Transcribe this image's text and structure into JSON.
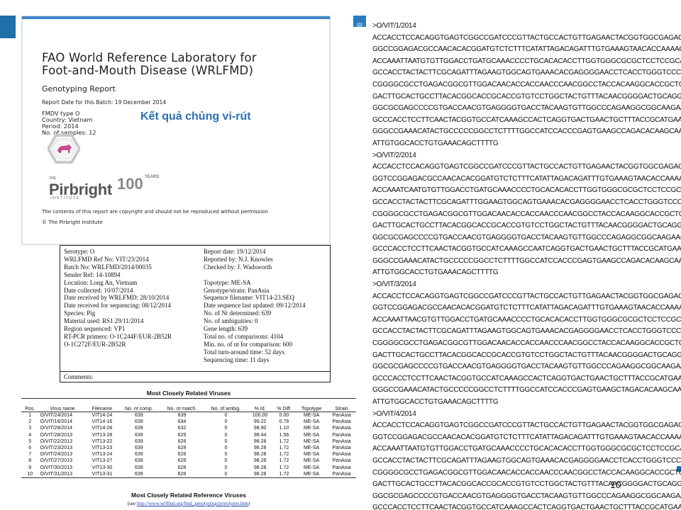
{
  "cover": {
    "title_line1": "FAO World Reference Laboratory for",
    "title_line2": "Foot-and-Mouth Disease (WRLFMD)",
    "subtitle": "Genotyping Report",
    "report_date_line": "Report Date for this Batch: 19 December 2014",
    "meta": [
      "FMDV type O",
      "Country: Vietnam",
      "Period: 2014",
      "No. of samples: 12"
    ],
    "overlay_label": "Kết quả chủng vi-rút",
    "logo_the": "THE",
    "logo_name": "Pirbright",
    "logo_years": "100",
    "logo_years_suffix": "YEARS",
    "logo_institute": "INSTITUTE",
    "copy_notice": "The contents of this report are copyright and should not be reproduced without permission",
    "copyright": "© The Pirbright Institute"
  },
  "details": {
    "left": [
      "Serotype: O",
      "WRLFMD Ref No: VIT/23/2014",
      "Batch No: WRLFMD/2014/00035",
      "Sender Ref: 14-10894",
      "Location: Long An, Vietnam",
      "Date collected: 10/07/2014",
      "Date received by WRLFMD: 28/10/2014",
      "Date received for sequencing: 08/12/2014",
      "Species: Pig",
      "Material used: RS1 29/11/2014",
      "Region sequenced: VP1",
      "RT-PCR primers: O-1C244F/EUR-2B52R",
      "                         O-1C272F/EUR-2B52R"
    ],
    "right": [
      "Report date: 19/12/2014",
      "Reported by: N.J. Knowles",
      "Checked by: J. Wadsworth",
      "",
      "Topotype: ME-SA",
      "Genotype/strain: PanAsia",
      "Sequence filename: VIT14-23.SEQ",
      "Date sequence last updated: 09/12/2014",
      "No. of Nt determined: 639",
      "No. of ambiguities: 0",
      "Gene length: 639",
      "Total no. of comparisons: 4104",
      "Min. no. of nt for comparison: 600",
      "Total turn-around time: 52 days",
      "Sequencing time: 11 days"
    ],
    "comments_label": "Comments:"
  },
  "related": {
    "title": "Most Closely Related Viruses",
    "headers": [
      "Pos.",
      "Virus name",
      "Filename",
      "No. nt comp.",
      "No. nt match.",
      "No. of ambig.",
      "% Id.",
      "% Diff.",
      "Topotype",
      "Strain"
    ],
    "rows": [
      [
        "1",
        "O/VIT/24/2014",
        "VIT14-24",
        "639",
        "639",
        "0",
        "100.00",
        "0.00",
        "ME-SA",
        "PanAsia"
      ],
      [
        "2",
        "O/VIT/16/2014",
        "VIT14-16",
        "639",
        "634",
        "0",
        "99.22",
        "0.78",
        "ME-SA",
        "PanAsia"
      ],
      [
        "3",
        "O/VIT/28/2014",
        "VIT14-28",
        "639",
        "632",
        "0",
        "98.90",
        "1.10",
        "ME-SA",
        "PanAsia"
      ],
      [
        "4",
        "O/VIT/28/2013",
        "VIT13-28",
        "639",
        "629",
        "0",
        "98.44",
        "1.56",
        "ME-SA",
        "PanAsia"
      ],
      [
        "5",
        "O/VIT/22/2013",
        "VIT13-22",
        "639",
        "628",
        "0",
        "98.28",
        "1.72",
        "ME-SA",
        "PanAsia"
      ],
      [
        "6",
        "O/VIT/23/2013",
        "VIT13-23",
        "639",
        "628",
        "0",
        "98.28",
        "1.72",
        "ME-SA",
        "PanAsia"
      ],
      [
        "7",
        "O/VIT/24/2013",
        "VIT13-24",
        "639",
        "628",
        "0",
        "98.28",
        "1.72",
        "ME-SA",
        "PanAsia"
      ],
      [
        "8",
        "O/VIT/27/2013",
        "VIT13-27",
        "639",
        "628",
        "0",
        "98.28",
        "1.72",
        "ME-SA",
        "PanAsia"
      ],
      [
        "9",
        "O/VIT/30/2013",
        "VIT13-30",
        "639",
        "628",
        "0",
        "98.28",
        "1.72",
        "ME-SA",
        "PanAsia"
      ],
      [
        "10",
        "O/VIT/31/2013",
        "VIT13-31",
        "639",
        "628",
        "0",
        "98.28",
        "1.72",
        "ME-SA",
        "PanAsia"
      ]
    ],
    "ref_title": "Most Closely Related Reference Viruses",
    "ref_prefix": "(see ",
    "ref_url": "http://www.wrlfmd.org/fmd_genotyping/prototypes.htm",
    "ref_suffix": ")"
  },
  "sequences": [
    ">O/VIT/1/2014",
    "ACCACCTCCACAGGTGAGTCGGCCGATCCCGTTACTGCCACTGTTGAGAACTACGGTGGCGAGACACA",
    "GGCCGGAGACGCCAACACACGGATGTCTCTTTCATATTAGACAGATTTGTGAAAGTAACACCAAAAG",
    "ACCAAATTAATGTGTTGGACCTGATGCAAACCCCTGCACACACCTTGGTGGGCGCGCTCCTCCGCACT",
    "GCCACCTACTACTTCGCAGATTTAGAAGTGGCAGTGAAACACGAGGGGAACCTCACCTGGGTCCCAAA",
    "CGGGGCGCCTGAGACGGCGTTGGACAACACCACCAACCCAACGGCCTACCACAAGGCACCGCTCACCC",
    "GACTTGCACTGCCTTACACGGCACCGCACCGTGTCCTGGCTACTGTTTACAACGGGGACTGCAGGTAC",
    "GGCGCGAGCCCCGTGACCAACGTGAGGGGTGACCTACAAGTGTTGGCCCAGAAGGCGGCAAGAACGCT",
    "GCCCACCTCCTTCAACTACGGTGCCATCAAAGCCACTCAGGTGACTGAACTGCTTTACCGCATGAAGA",
    "GGGCCGAAACATACTGCCCCCGGCCTCTTTTGGCCATCCACCCGAGTGAAGCCAGACACAAGCAAAAG",
    "ATTGTGGCACCTGTGAAACAGCTTTTG",
    ">O/VIT/2/2014",
    "ACCACCTCCACAGGTGAGTCGGCCGATCCCGTTACTGCCACTGTTGAGAACTACGGTGGCGAGACACA",
    "GGTCCGGAGACGCCAACACACGGATGTCTCTTTCATATTAGACAGATTTGTGAAAGTAACACCAAAAG",
    "ACCAAATCAATGTGTTGGACCTGATGCAAACCCCTGCACACACCTTGGTGGGCGCGCTCCTCCGCACT",
    "GCCACCTACTACTTCGCAGATTTGGAAGTGGCAGTGAAACACGAGGGGAACCTCACCTGGGTCCCAAA",
    "CGGGGCGCCTGAGACGGCGTTGGACAACACCACCAACCCAACGGCCTACCACAAGGCACCGCTCACCC",
    "GACTTGCACTGCCTTACACGGCACCGCACCGTGTCCTGGCTACTGTTTACAACGGGGACTGCAGGTAC",
    "GGCGCGAGCCCCGTGACCAACGTGAGGGGTGACCTACAAGTGTTGGCCCAGAGGCGGCAAGAACGCT",
    "GCCCACCTCCTTCAACTACGGTGCCATCAAAGCCAATCAGGTGACTGAACTGCTTTACCGCATGAAGA",
    "GGGCCGAAACATACTGCCCCCGGCCTCTTTTGGCCATCCACCCGAGTGAAGCCAGACACAAGCAAAAG",
    "ATTGTGGCACCTGTGAAACAGCTTTTG",
    ">O/VIT/3/2014",
    "ACCACCTCCACAGGTGAGTCGGCCGATCCCGTTACTGCCACTGTTGAGAACTACGGTGGCGAGACACA",
    "GGTCCGGAGACGCCAACACACGGATGTCTCTTTCATATTAGACAGATTTGTGAAAGTAACACCAAAAG",
    "ACCAAATTAACGTGTTGGACCTGATGCAAACCCCTGCACACACCTTGGTGGGCGCGCTCCTCCGCACT",
    "GCCACCTACTACTTCGCAGATTTAGAAGTGGCAGTGAAACACGAGGGGAACCTCACCTGGGTCCCAAA",
    "CGGGGCGCCTGAGACGGCGTTGGACAACACCACCAACCCAACGGCCTACCACAAGGCACCGCTCACCC",
    "GACTTGCACTGCCTTACACGGCACCGCACCGTGTCCTGGCTACTGTTTACAACGGGGACTGCAGGTAC",
    "GGCGCGAGCCCCGTGACCAACGTGAGGGGTGACCTACAAGTGTTGGCCCAGAAGGCGGCAAGAACGCT",
    "GCCCACCTCCTTCAACTACGGTGCCATCAAAGCCACTCAGGTGACTGAACTGCTTTACCGCATGAAGA",
    "GGGCCGAAACATACTGCCCCCGGCCTCTTTTGGCCATCCACCCGAGTGAAGCTAGACACAAGCAAAAG",
    "ATTGTGGCACCTGTGAAACAGCTTTTG",
    ">O/VIT/4/2014",
    "ACCACCTCCACAGGTGAGTCGGCCGATCCCGTTACTGCCACTGTTGAGAACTACGGTGGCGAGACACA",
    "GGTCCGGAGACGCCAACACACGGATGTCTCTTTCATATTAGACAGATTTGTGAAAGTAACACCAAAAG",
    "ACCAAATTAATGTGTTGGACCTGATGCAAACCCCTGCACACACCTTGGTGGGCGCGCTCCTCCGCACT",
    "GCCACCTACTACTTCGCAGATTTAGAAGTGGCAGTGAAACACGAGGGGAACCTCACCTGGGTCCCAAA",
    "CGGGGCGCCTGAGACGGCGTTGGACAACACCACCAACCCAACGGCCTACCACAAGGCACCGCTCACCC",
    "GACTTGCACTGCCTTACACGGCACCGCACCGTGTCCTGGCTACTGTTTACAACGGGGACTGCAGGTAC",
    "GGCGCGAGCCCCGTGACCAACGTGAGGGGTGACCTACAAGTGTTGGCCCAGAAGGCGGCAAGAACGCT",
    "GCCCACCTCCTTCAACTACGGTGCCATCAAAGCCACTCAGGTGACTGAACTGCTTTACCGCATGAAGA"
  ],
  "page_number": "10",
  "colors": {
    "accent": "#1f6fa8",
    "label_blue": "#2a6fb5",
    "link": "#1b3fb0"
  }
}
